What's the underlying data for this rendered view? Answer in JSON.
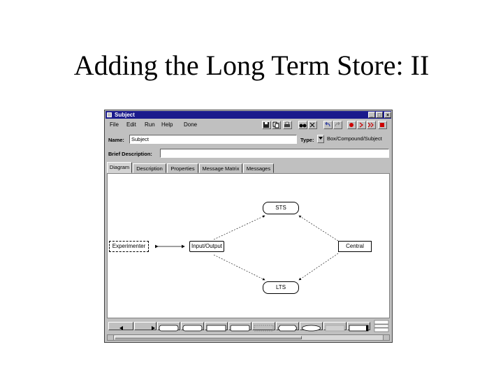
{
  "slide_title": "Adding the Long Term Store: II",
  "window": {
    "title": "Subject",
    "controls": [
      "_",
      "□",
      "×"
    ]
  },
  "menu": [
    "File",
    "Edit",
    "Run",
    "Help",
    "Done"
  ],
  "toolbar": {
    "save_icon": "floppy-icon",
    "copy_icon": "copy-icon",
    "print_icon": "print-icon",
    "find_icon": "binoculars-icon",
    "undo_icon": "undo-icon",
    "redo_icon": "redo-icon",
    "record_icon": "record-icon",
    "play_icon": "play-icon",
    "fast_forward_icon": "fast-forward-icon",
    "stop_icon": "stop-icon",
    "record_color": "#cc0000"
  },
  "form": {
    "name_label": "Name:",
    "name_value": "Subject",
    "type_label": "Type:",
    "type_value": "Box/Compound/Subject",
    "brief_label": "Brief Description:",
    "brief_value": ""
  },
  "tabs": [
    "Diagram",
    "Description",
    "Properties",
    "Message Matrix",
    "Messages"
  ],
  "diagram": {
    "nodes": {
      "experimenter": "Experimenter",
      "input_output": "Input/Output",
      "sts": "STS",
      "central": "Central",
      "lts": "LTS"
    }
  }
}
